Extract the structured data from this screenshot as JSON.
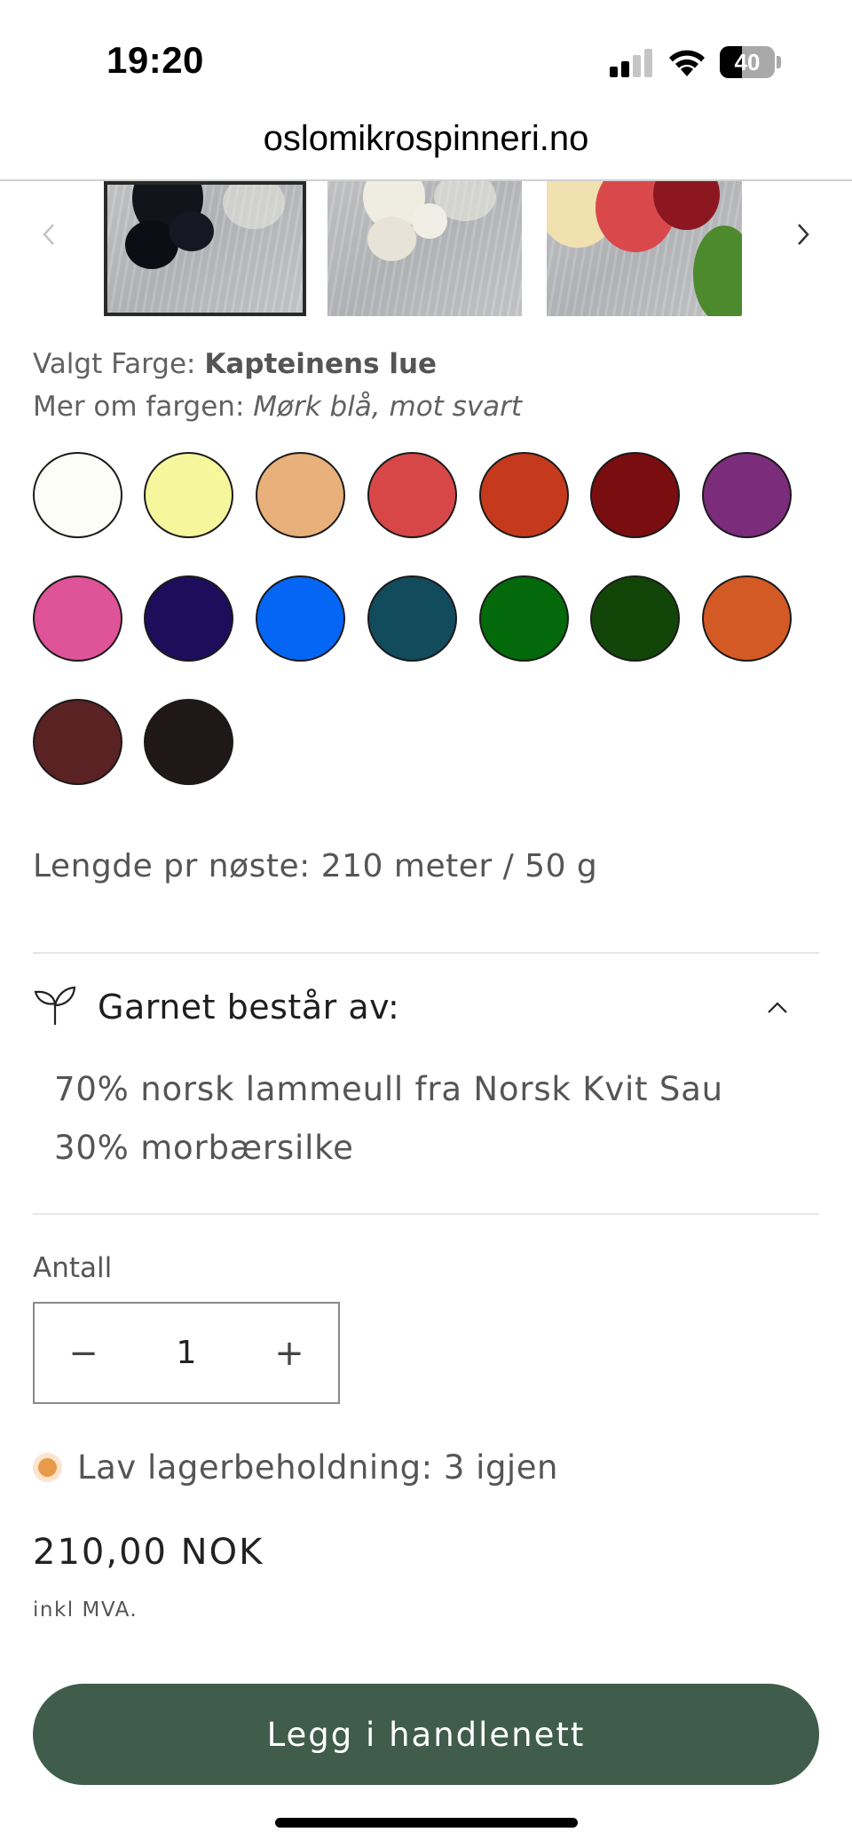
{
  "status_bar": {
    "time": "19:20",
    "battery_level": "40",
    "signal_bars_active": 2,
    "signal_bars_total": 4
  },
  "url_bar": {
    "domain": "oslomikrospinneri.no"
  },
  "carousel": {
    "thumbnails": [
      {
        "name": "navy-yarn-thumbnail",
        "selected": true
      },
      {
        "name": "white-yarn-thumbnail",
        "selected": false
      },
      {
        "name": "multicolor-yarn-thumbnail",
        "selected": false
      }
    ],
    "prev_icon": "chevron-left-icon",
    "next_icon": "chevron-right-icon"
  },
  "color_selection": {
    "label": "Valgt Farge: ",
    "value": "Kapteinens lue",
    "more_label": "Mer om fargen: ",
    "more_value": "Mørk blå, mot svart"
  },
  "swatches": [
    {
      "color": "#fdfdf7"
    },
    {
      "color": "#f6f69c"
    },
    {
      "color": "#e8b07a"
    },
    {
      "color": "#d84747"
    },
    {
      "color": "#c53a1c"
    },
    {
      "color": "#7a0d10"
    },
    {
      "color": "#7b2c7b"
    },
    {
      "color": "#df5398"
    },
    {
      "color": "#1e0d5b"
    },
    {
      "color": "#0566f6"
    },
    {
      "color": "#114b5c"
    },
    {
      "color": "#03690a"
    },
    {
      "color": "#114608"
    },
    {
      "color": "#d35a25"
    },
    {
      "color": "#5a2223"
    },
    {
      "color": "#201719"
    }
  ],
  "length": "Lengde pr nøste: 210 meter / 50 g",
  "accordion": {
    "title": "Garnet består av:",
    "icon": "leaf-icon",
    "expanded": true,
    "lines": [
      "70% norsk lammeull fra Norsk Kvit Sau",
      "30% morbærsilke"
    ]
  },
  "quantity": {
    "label": "Antall",
    "value": "1",
    "minus": "−",
    "plus": "+"
  },
  "stock": {
    "text": "Lav lagerbeholdning: 3 igjen",
    "status_color": "#e8994a"
  },
  "price": {
    "amount": "210,00 NOK",
    "tax_note": "inkl MVA."
  },
  "cta": {
    "label": "Legg i handlenett",
    "color": "#405c4b"
  }
}
